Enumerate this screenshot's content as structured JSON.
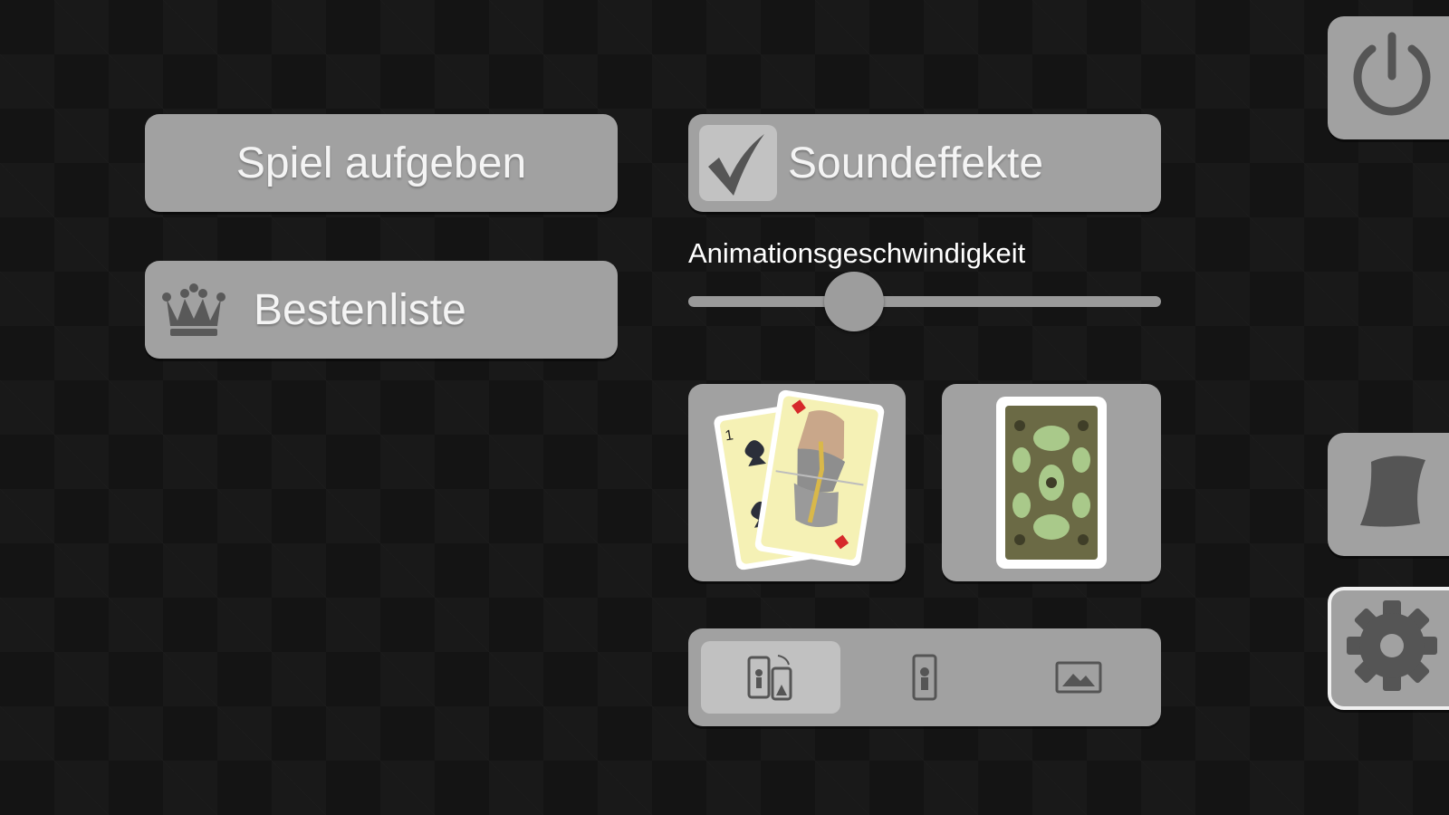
{
  "menu": {
    "quit_label": "Spiel aufgeben",
    "leaderboard_label": "Bestenliste"
  },
  "settings": {
    "sound_label": "Soundeffekte",
    "sound_enabled": true,
    "animation_label": "Animationsgeschwindigkeit",
    "animation_speed_fraction": 0.33
  },
  "deck": {
    "face_design": "card-faces-icon",
    "back_design": "card-back-icon"
  },
  "orientation": {
    "options": [
      "auto-rotate-icon",
      "portrait-icon",
      "landscape-icon"
    ],
    "selected_index": 0
  },
  "sidebar": {
    "icons": [
      "power-icon",
      "theme-icon",
      "gear-icon"
    ],
    "active": "gear-icon"
  },
  "colors": {
    "background": "#141414",
    "button": "#a1a1a1",
    "button_text": "#f4f4f4",
    "icon_dark": "#555555",
    "card_red": "#d62a2a",
    "card_face": "#f5f1b5"
  }
}
